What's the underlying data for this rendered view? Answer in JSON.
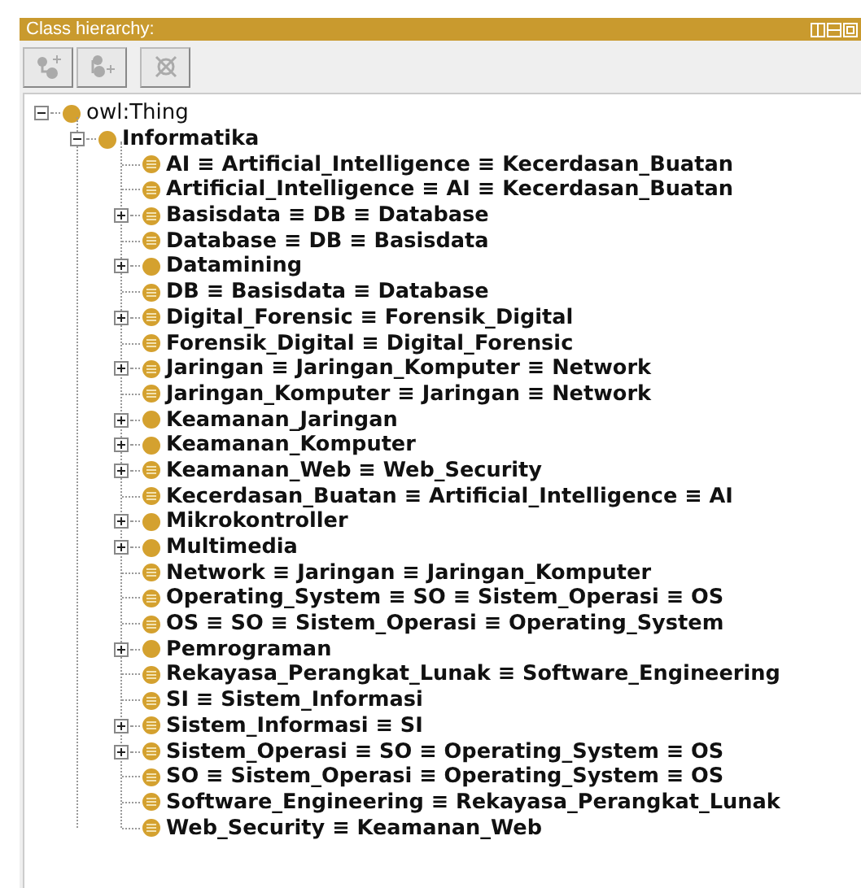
{
  "panel": {
    "title": "Class hierarchy:"
  },
  "tree": [
    {
      "label": "owl:Thing",
      "kind": "class",
      "expanded": true,
      "children": [
        {
          "label": "Informatika",
          "kind": "class",
          "expanded": true,
          "children": [
            {
              "label": "AI ≡ Artificial_Intelligence ≡ Kecerdasan_Buatan",
              "kind": "equivalent"
            },
            {
              "label": "Artificial_Intelligence ≡ AI ≡ Kecerdasan_Buatan",
              "kind": "equivalent"
            },
            {
              "label": "Basisdata ≡ DB ≡ Database",
              "kind": "equivalent",
              "expanded": false
            },
            {
              "label": "Database ≡ DB ≡ Basisdata",
              "kind": "equivalent"
            },
            {
              "label": "Datamining",
              "kind": "class",
              "expanded": false
            },
            {
              "label": "DB ≡ Basisdata ≡ Database",
              "kind": "equivalent"
            },
            {
              "label": "Digital_Forensic ≡ Forensik_Digital",
              "kind": "equivalent",
              "expanded": false
            },
            {
              "label": "Forensik_Digital ≡ Digital_Forensic",
              "kind": "equivalent"
            },
            {
              "label": "Jaringan ≡ Jaringan_Komputer ≡ Network",
              "kind": "equivalent",
              "expanded": false
            },
            {
              "label": "Jaringan_Komputer ≡ Jaringan ≡ Network",
              "kind": "equivalent"
            },
            {
              "label": "Keamanan_Jaringan",
              "kind": "class",
              "expanded": false
            },
            {
              "label": "Keamanan_Komputer",
              "kind": "class",
              "expanded": false
            },
            {
              "label": "Keamanan_Web ≡ Web_Security",
              "kind": "equivalent",
              "expanded": false
            },
            {
              "label": "Kecerdasan_Buatan ≡ Artificial_Intelligence ≡ AI",
              "kind": "equivalent"
            },
            {
              "label": "Mikrokontroller",
              "kind": "class",
              "expanded": false
            },
            {
              "label": "Multimedia",
              "kind": "class",
              "expanded": false
            },
            {
              "label": "Network ≡ Jaringan ≡ Jaringan_Komputer",
              "kind": "equivalent"
            },
            {
              "label": "Operating_System ≡ SO ≡ Sistem_Operasi ≡ OS",
              "kind": "equivalent"
            },
            {
              "label": "OS ≡ SO ≡ Sistem_Operasi ≡ Operating_System",
              "kind": "equivalent"
            },
            {
              "label": "Pemrograman",
              "kind": "class",
              "expanded": false
            },
            {
              "label": "Rekayasa_Perangkat_Lunak ≡ Software_Engineering",
              "kind": "equivalent"
            },
            {
              "label": "SI ≡ Sistem_Informasi",
              "kind": "equivalent"
            },
            {
              "label": "Sistem_Informasi ≡ SI",
              "kind": "equivalent",
              "expanded": false
            },
            {
              "label": "Sistem_Operasi ≡ SO ≡ Operating_System ≡ OS",
              "kind": "equivalent",
              "expanded": false
            },
            {
              "label": "SO ≡ Sistem_Operasi ≡ Operating_System ≡ OS",
              "kind": "equivalent"
            },
            {
              "label": "Software_Engineering ≡ Rekayasa_Perangkat_Lunak",
              "kind": "equivalent"
            },
            {
              "label": "Web_Security ≡ Keamanan_Web",
              "kind": "equivalent"
            }
          ]
        }
      ]
    }
  ]
}
